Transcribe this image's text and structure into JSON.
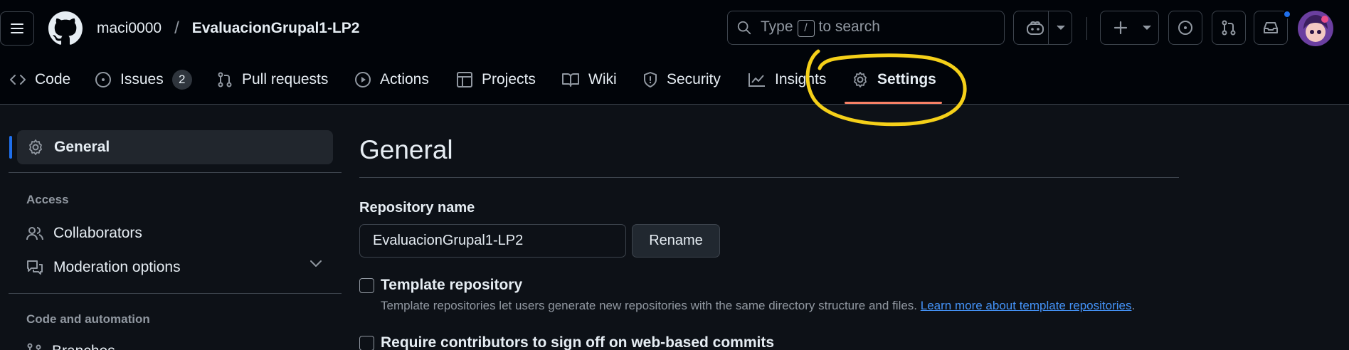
{
  "header": {
    "owner": "maci0000",
    "separator": "/",
    "repo": "EvaluacionGrupal1-LP2",
    "search": {
      "prefix": "Type",
      "key": "/",
      "suffix": "to search"
    }
  },
  "tabs": [
    {
      "label": "Code",
      "icon": "code-icon"
    },
    {
      "label": "Issues",
      "icon": "issue-icon",
      "count": "2"
    },
    {
      "label": "Pull requests",
      "icon": "pull-request-icon"
    },
    {
      "label": "Actions",
      "icon": "play-icon"
    },
    {
      "label": "Projects",
      "icon": "table-icon"
    },
    {
      "label": "Wiki",
      "icon": "book-icon"
    },
    {
      "label": "Security",
      "icon": "shield-icon"
    },
    {
      "label": "Insights",
      "icon": "graph-icon"
    },
    {
      "label": "Settings",
      "icon": "gear-icon",
      "selected": true
    }
  ],
  "sidebar": {
    "active_item": "General",
    "sections": [
      {
        "heading": "Access",
        "items": [
          "Collaborators",
          "Moderation options"
        ]
      },
      {
        "heading": "Code and automation",
        "items": [
          "Branches"
        ]
      }
    ]
  },
  "main": {
    "title": "General",
    "repo_name_label": "Repository name",
    "repo_name_value": "EvaluacionGrupal1-LP2",
    "rename_label": "Rename",
    "template_label": "Template repository",
    "template_desc": "Template repositories let users generate new repositories with the same directory structure and files.",
    "template_link": "Learn more about template repositories",
    "template_desc_end": ".",
    "signoff_label": "Require contributors to sign off on web-based commits"
  },
  "colors": {
    "background": "#0d1117",
    "header_bg": "#010409",
    "accent_underline": "#f78166",
    "link": "#4493f8",
    "highlight_annotation": "#f5d019"
  }
}
